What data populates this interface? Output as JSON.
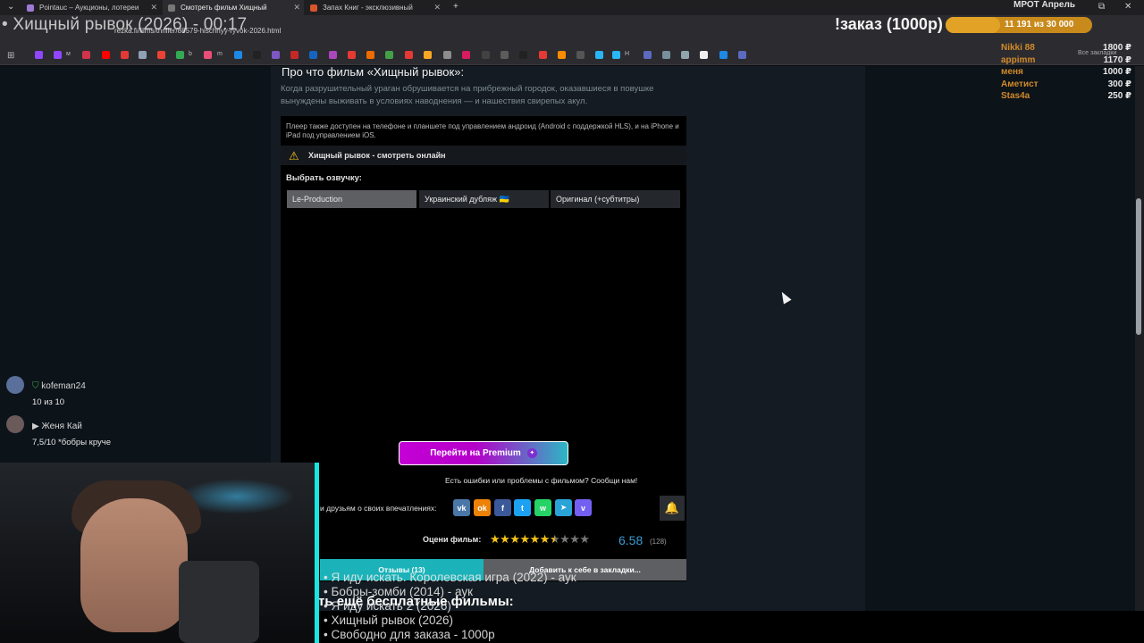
{
  "browser": {
    "tabs": [
      {
        "label": "Pointauc – Аукционы, лотереи",
        "favicon_color": "#9b7bd6"
      },
      {
        "label": "Смотреть фильм Хищный",
        "favicon_color": "#777777"
      },
      {
        "label": "Запах Книг - эксклюзивный",
        "favicon_color": "#d9552b"
      }
    ],
    "url": "rezka.fi/films/thriller/88579-hischnyy-ryvok-2026.html",
    "all_bookmarks_label": "Все закладки",
    "bookmark_labels": [
      "м",
      "b",
      "m",
      "H"
    ]
  },
  "stream": {
    "title": "• Хищный рывок (2026) - 00:17",
    "order_text": "!заказ (1000р)",
    "goal_text": "11 191 из 30 000",
    "goal_progress": 0.373,
    "mrot_label": "МРОТ Апрель",
    "donors": [
      {
        "name": "Nikki 88",
        "amount": "1800 ₽",
        "color": "#d28a2a"
      },
      {
        "name": "appimm",
        "amount": "1170 ₽",
        "color": "#d28a2a"
      },
      {
        "name": "меня",
        "amount": "1000 ₽",
        "color": "#d28a2a"
      },
      {
        "name": "Аметист",
        "amount": "300 ₽",
        "color": "#d28a2a"
      },
      {
        "name": "Stas4a",
        "amount": "250 ₽",
        "color": "#d28a2a"
      }
    ]
  },
  "page": {
    "about_heading": "Про что фильм «Хищный рывок»:",
    "about_desc": "Когда разрушительный ураган обрушивается на прибрежный городок, оказавшиеся в повушке вынуждены выживать в условиях наводнения — и нашествия свирепых акул.",
    "player_note": "Плеер также доступен на телефоне и планшете под управлением андроид (Android с поддержкой HLS), и на iPhone и iPad под управлением iOS.",
    "warn_icon": "warning-icon",
    "watch_title": "Хищный рывок - смотреть онлайн",
    "voice_label": "Выбрать озвучку:",
    "voices": [
      "Le-Production",
      "Украинский дубляж 🇺🇦",
      "Оригинал (+субтитры)"
    ],
    "premium_button": "Перейти на Premium",
    "report_text": "Есть ошибки или проблемы с фильмом? Сообщи нам!",
    "share_text": "и друзьям о своих впечатлениях:",
    "social_buttons": [
      {
        "name": "vk",
        "glyph": "vk",
        "color": "#4a76a8"
      },
      {
        "name": "ok",
        "glyph": "ok",
        "color": "#ee8208"
      },
      {
        "name": "facebook",
        "glyph": "f",
        "color": "#3b5998"
      },
      {
        "name": "twitter",
        "glyph": "t",
        "color": "#1da1f2"
      },
      {
        "name": "whatsapp",
        "glyph": "w",
        "color": "#25d366"
      },
      {
        "name": "telegram",
        "glyph": "➤",
        "color": "#2aa3d7"
      },
      {
        "name": "viber",
        "glyph": "v",
        "color": "#7360f2"
      }
    ],
    "rate_label": "Оцени фильм:",
    "rating_value": "6.58",
    "rating_count": "(128)",
    "rating_fraction": 0.658,
    "reviews_button": "Отзывы (13)",
    "add_bookmark_button": "Добавить к себе в закладки...",
    "free_heading": "ть ещё бесплатные фильмы:"
  },
  "order_list": [
    "• Я иду искать. Королевская игра (2022) - аук",
    "• Бобры-зомби (2014) - аук",
    "• Я иду искать 2 (2026)",
    "• Хищный рывок (2026)",
    "• Свободно для заказа - 1000р"
  ],
  "chat": [
    {
      "user": "kofeman24",
      "message": "10 из 10",
      "avatar_color": "#5a6f9a",
      "badge": "shield-icon"
    },
    {
      "user": "Женя Кай",
      "message": "7,5/10 *бобры круче",
      "avatar_color": "#6b5a5a",
      "badge": "play-icon"
    }
  ]
}
